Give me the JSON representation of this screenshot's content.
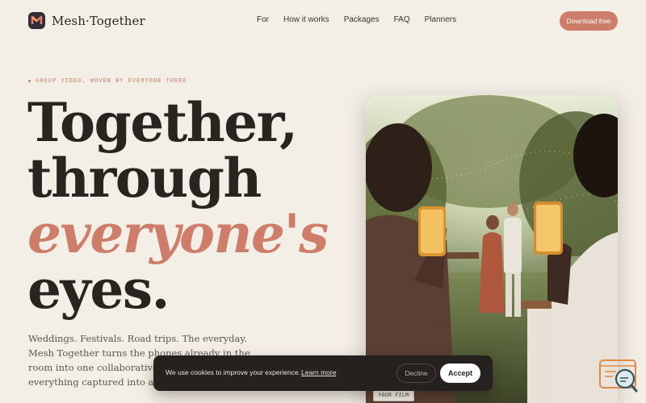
{
  "brand": {
    "name": "Mesh·Together",
    "accent_color": "#cf7d6b",
    "logo_color": "#2f2d3a"
  },
  "nav": {
    "items": [
      "For",
      "How it works",
      "Packages",
      "FAQ",
      "Planners"
    ],
    "cta_label": "Download free"
  },
  "hero": {
    "eyebrow": "GROUP VIDEO, WOVEN BY EVERYONE THERE",
    "headline_lines": [
      "Together,",
      "through",
      "everyone's",
      "eyes."
    ],
    "lede": "Weddings. Festivals. Road trips. The everyday. Mesh Together turns the phones already in the room into one collaborative camera, and everything captured into a film worth keeping."
  },
  "photo": {
    "label": "YOUR FILM",
    "icon": "wedding-scene-photo"
  },
  "cookie_banner": {
    "message": "We use cookies to improve your experience.",
    "link_label": "Learn more",
    "decline_label": "Decline",
    "accept_label": "Accept"
  },
  "chat_widget": {
    "icon": "chat-search-icon"
  }
}
